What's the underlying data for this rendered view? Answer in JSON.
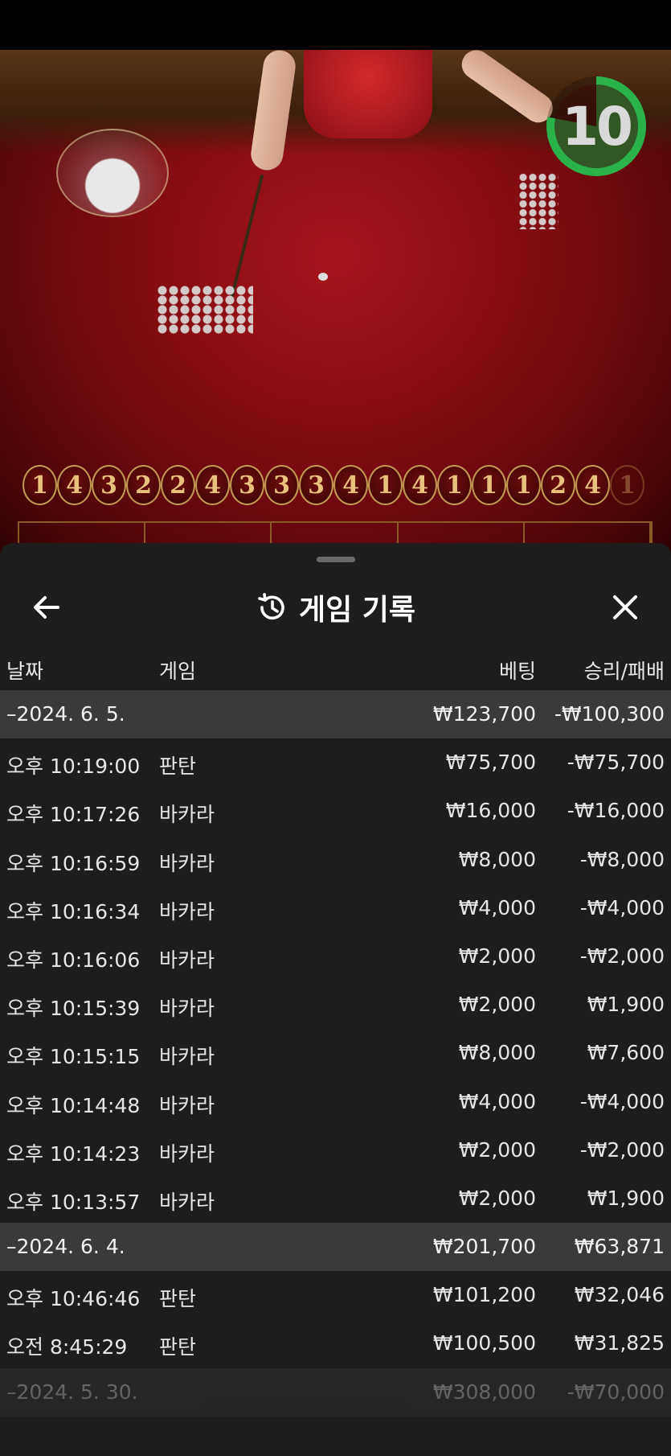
{
  "game_scene": {
    "timer": "10",
    "road_results": [
      "1",
      "4",
      "3",
      "2",
      "2",
      "4",
      "3",
      "3",
      "3",
      "4",
      "1",
      "4",
      "1",
      "1",
      "1",
      "2",
      "4",
      "1"
    ]
  },
  "sheet": {
    "title": "게임 기록",
    "columns": {
      "date": "날짜",
      "game": "게임",
      "bet": "베팅",
      "winloss": "승리/패배"
    },
    "rows": [
      {
        "type": "date",
        "time": "–2024. 6. 5.",
        "game": "",
        "bet": "₩123,700",
        "winloss": "-₩100,300"
      },
      {
        "type": "item",
        "time": "오후 10:19:00",
        "game": "판탄",
        "bet": "₩75,700",
        "winloss": "-₩75,700"
      },
      {
        "type": "item",
        "time": "오후 10:17:26",
        "game": "바카라",
        "bet": "₩16,000",
        "winloss": "-₩16,000"
      },
      {
        "type": "item",
        "time": "오후 10:16:59",
        "game": "바카라",
        "bet": "₩8,000",
        "winloss": "-₩8,000"
      },
      {
        "type": "item",
        "time": "오후 10:16:34",
        "game": "바카라",
        "bet": "₩4,000",
        "winloss": "-₩4,000"
      },
      {
        "type": "item",
        "time": "오후 10:16:06",
        "game": "바카라",
        "bet": "₩2,000",
        "winloss": "-₩2,000"
      },
      {
        "type": "item",
        "time": "오후 10:15:39",
        "game": "바카라",
        "bet": "₩2,000",
        "winloss": "₩1,900"
      },
      {
        "type": "item",
        "time": "오후 10:15:15",
        "game": "바카라",
        "bet": "₩8,000",
        "winloss": "₩7,600"
      },
      {
        "type": "item",
        "time": "오후 10:14:48",
        "game": "바카라",
        "bet": "₩4,000",
        "winloss": "-₩4,000"
      },
      {
        "type": "item",
        "time": "오후 10:14:23",
        "game": "바카라",
        "bet": "₩2,000",
        "winloss": "-₩2,000"
      },
      {
        "type": "item",
        "time": "오후 10:13:57",
        "game": "바카라",
        "bet": "₩2,000",
        "winloss": "₩1,900"
      },
      {
        "type": "date",
        "time": "–2024. 6. 4.",
        "game": "",
        "bet": "₩201,700",
        "winloss": "₩63,871"
      },
      {
        "type": "item",
        "time": "오후 10:46:46",
        "game": "판탄",
        "bet": "₩101,200",
        "winloss": "₩32,046"
      },
      {
        "type": "item",
        "time": "오전 8:45:29",
        "game": "판탄",
        "bet": "₩100,500",
        "winloss": "₩31,825"
      },
      {
        "type": "date",
        "time": "–2024. 5. 30.",
        "game": "",
        "bet": "₩308,000",
        "winloss": "-₩70,000"
      }
    ]
  },
  "colors": {
    "timer_ring": "#2bb34a",
    "sheet_bg": "#1d1d1d",
    "date_row_bg": "#3a3a3a",
    "road_gold": "#e8c27c"
  },
  "icons": [
    "back-arrow-icon",
    "history-icon",
    "close-icon"
  ]
}
